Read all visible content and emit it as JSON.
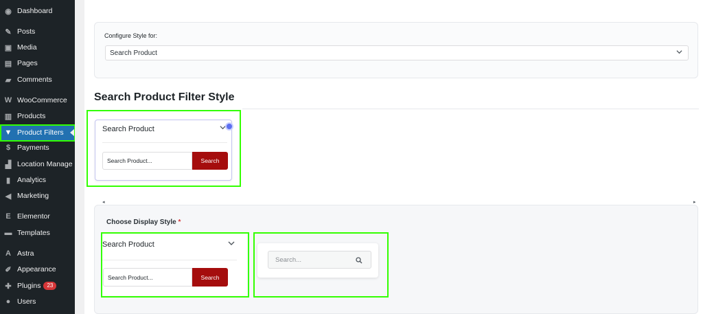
{
  "sidebar": {
    "items": [
      {
        "label": "Dashboard",
        "icon": "dashboard-icon",
        "glyph": "◉"
      },
      {
        "label": "Posts",
        "icon": "pin-icon",
        "glyph": "✎"
      },
      {
        "label": "Media",
        "icon": "media-icon",
        "glyph": "▣"
      },
      {
        "label": "Pages",
        "icon": "pages-icon",
        "glyph": "▤"
      },
      {
        "label": "Comments",
        "icon": "comments-icon",
        "glyph": "▰"
      },
      {
        "label": "WooCommerce",
        "icon": "woocommerce-icon",
        "glyph": "W"
      },
      {
        "label": "Products",
        "icon": "products-icon",
        "glyph": "▥"
      },
      {
        "label": "Product Filters",
        "icon": "filter-icon",
        "glyph": "▼"
      },
      {
        "label": "Payments",
        "icon": "payments-icon",
        "glyph": "$"
      },
      {
        "label": "Location Manage",
        "icon": "location-icon",
        "glyph": "▟"
      },
      {
        "label": "Analytics",
        "icon": "analytics-icon",
        "glyph": "▮"
      },
      {
        "label": "Marketing",
        "icon": "marketing-icon",
        "glyph": "◀"
      },
      {
        "label": "Elementor",
        "icon": "elementor-icon",
        "glyph": "E"
      },
      {
        "label": "Templates",
        "icon": "templates-icon",
        "glyph": "▬"
      },
      {
        "label": "Astra",
        "icon": "astra-icon",
        "glyph": "A"
      },
      {
        "label": "Appearance",
        "icon": "appearance-icon",
        "glyph": "✐"
      },
      {
        "label": "Plugins",
        "icon": "plugins-icon",
        "glyph": "✚",
        "badge": "23"
      },
      {
        "label": "Users",
        "icon": "users-icon",
        "glyph": "●"
      }
    ]
  },
  "config": {
    "label": "Configure Style for:",
    "selected": "Search Product"
  },
  "section_title": "Search Product Filter Style",
  "preview": {
    "title": "Search Product",
    "input_value": "Search Product...",
    "button_label": "Search"
  },
  "choose": {
    "label": "Choose Display Style",
    "required_mark": "*",
    "option1": {
      "title": "Search Product",
      "input_value": "Search Product...",
      "button_label": "Search"
    },
    "option2": {
      "placeholder": "Search..."
    }
  },
  "colors": {
    "sidebar_bg": "#1d2327",
    "active_bg": "#2271b1",
    "search_button": "#a50d0d",
    "highlight_frame": "#32ff00"
  }
}
